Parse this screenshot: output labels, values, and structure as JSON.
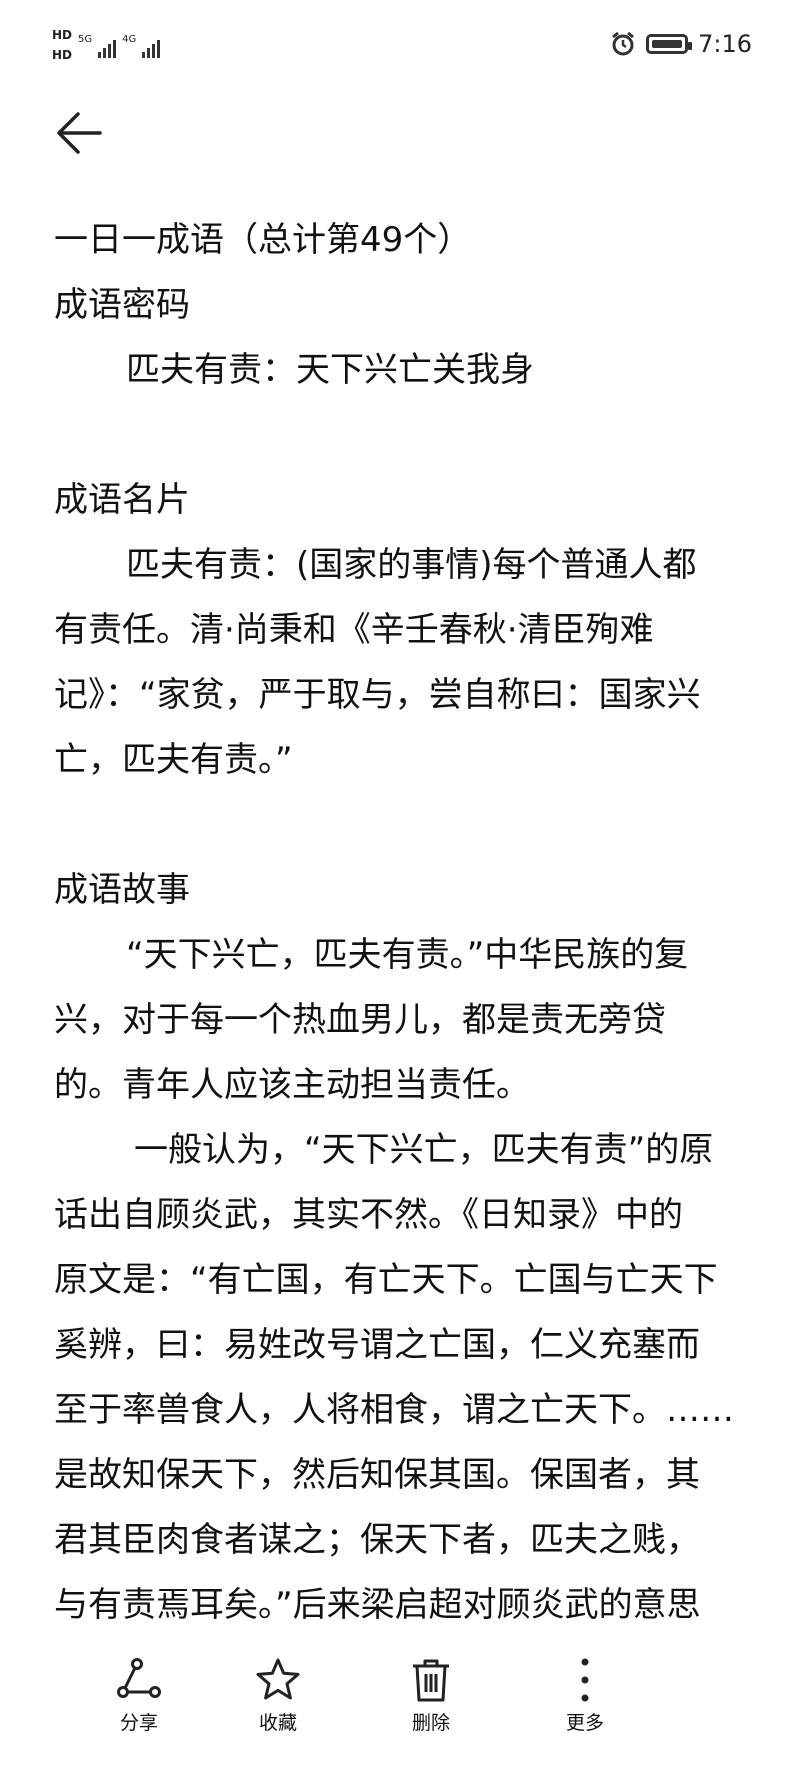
{
  "status_bar": {
    "hd1": "HD",
    "hd2": "HD",
    "net1": "5G",
    "net2": "4G",
    "time": "7:16"
  },
  "article": {
    "title": "一日一成语（总计第49个）",
    "sections": [
      {
        "heading": "成语密码",
        "lines": [
          "匹夫有责：天下兴亡关我身"
        ]
      },
      {
        "heading": "成语名片",
        "lines": [
          "匹夫有责：(国家的事情)每个普通人都",
          "有责任。清·尚秉和《辛壬春秋·清臣殉难",
          "记》：“家贫，严于取与，尝自称曰：国家兴",
          "亡，匹夫有责。”"
        ]
      },
      {
        "heading": "成语故事",
        "lines": [
          "“天下兴亡，匹夫有责。”中华民族的复",
          "兴，对于每一个热血男儿，都是责无旁贷",
          "的。青年人应该主动担当责任。",
          "一般认为，“天下兴亡，匹夫有责”的原",
          "话出自顾炎武，其实不然。《日知录》中的",
          "原文是：“有亡国，有亡天下。亡国与亡天下",
          "奚辨，曰：易姓改号谓之亡国，仁义充塞而",
          "至于率兽食人，人将相食，谓之亡天下。……",
          "是故知保天下，然后知保其国。保国者，其",
          "君其臣肉食者谋之；保天下者，匹夫之贱，",
          "与有责焉耳矣。”后来梁启超对顾炎武的意思"
        ]
      }
    ]
  },
  "toolbar": {
    "share": {
      "label": "分享",
      "icon": "share-icon"
    },
    "favorite": {
      "label": "收藏",
      "icon": "star-icon"
    },
    "delete": {
      "label": "删除",
      "icon": "trash-icon"
    },
    "more": {
      "label": "更多",
      "icon": "more-vertical-icon"
    }
  }
}
